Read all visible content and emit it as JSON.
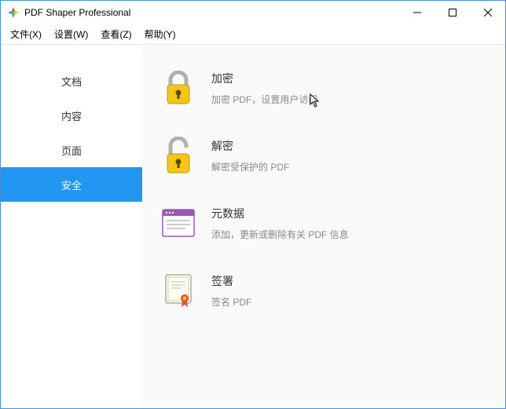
{
  "titlebar": {
    "title": "PDF Shaper Professional"
  },
  "menu": {
    "file": "文件(X)",
    "settings": "设置(W)",
    "view": "查看(Z)",
    "help": "帮助(Y)"
  },
  "sidebar": {
    "items": [
      {
        "label": "文档"
      },
      {
        "label": "内容"
      },
      {
        "label": "页面"
      },
      {
        "label": "安全"
      }
    ]
  },
  "rows": {
    "encrypt": {
      "title": "加密",
      "desc": "加密 PDF，设置用户访问"
    },
    "decrypt": {
      "title": "解密",
      "desc": "解密受保护的 PDF"
    },
    "metadata": {
      "title": "元数据",
      "desc": "添加，更新或删除有关 PDF 信息"
    },
    "sign": {
      "title": "签署",
      "desc": "签名 PDF"
    }
  }
}
